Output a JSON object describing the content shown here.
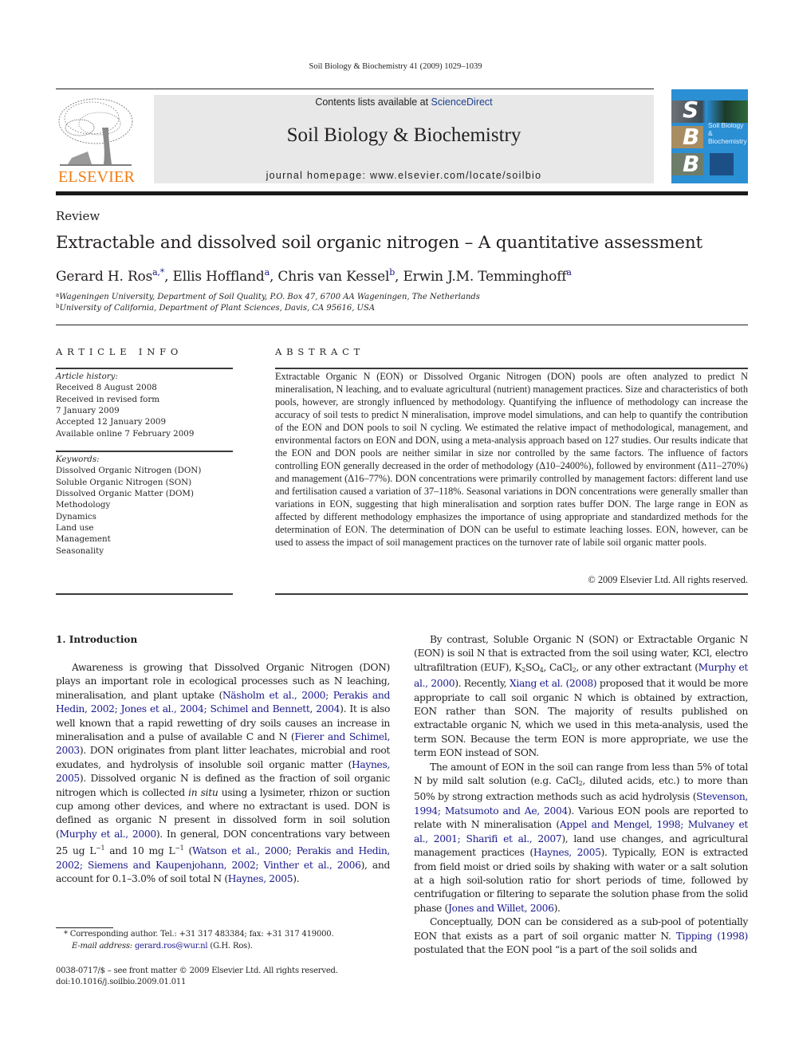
{
  "running_head": "Soil Biology & Biochemistry 41 (2009) 1029–1039",
  "masthead": {
    "publisher_wordmark": "ELSEVIER",
    "contents_prefix": "Contents lists available at ",
    "contents_link": "ScienceDirect",
    "journal_title": "Soil Biology & Biochemistry",
    "homepage": "journal homepage: www.elsevier.com/locate/soilbio",
    "cover": {
      "letters": [
        "S",
        "B",
        "B"
      ],
      "title_line1": "Soil Biology &",
      "title_line2": "Biochemistry",
      "color": "#2b8fd4"
    },
    "wordmark_color": "#f07c12"
  },
  "article": {
    "section_type": "Review",
    "title": "Extractable and dissolved soil organic nitrogen – A quantitative assessment",
    "authors": [
      {
        "name": "Gerard H. Ros",
        "sup": "a,*",
        "sep": ", "
      },
      {
        "name": "Ellis Hoffland",
        "sup": "a",
        "sep": ", "
      },
      {
        "name": "Chris van Kessel",
        "sup": "b",
        "sep": ", "
      },
      {
        "name": "Erwin J.M. Temminghoff",
        "sup": "a",
        "sep": ""
      }
    ],
    "affiliations": [
      {
        "mark": "a",
        "text": "Wageningen University, Department of Soil Quality, P.O. Box 47, 6700 AA Wageningen, The Netherlands"
      },
      {
        "mark": "b",
        "text": "University of California, Department of Plant Sciences, Davis, CA 95616, USA"
      }
    ]
  },
  "article_info": {
    "heading": "ARTICLE INFO",
    "history_label": "Article history:",
    "history": [
      "Received 8 August 2008",
      "Received in revised form",
      "7 January 2009",
      "Accepted 12 January 2009",
      "Available online 7 February 2009"
    ],
    "keywords_label": "Keywords:",
    "keywords": [
      "Dissolved Organic Nitrogen (DON)",
      "Soluble Organic Nitrogen (SON)",
      "Dissolved Organic Matter (DOM)",
      "Methodology",
      "Dynamics",
      "Land use",
      "Management",
      "Seasonality"
    ]
  },
  "abstract": {
    "heading": "ABSTRACT",
    "text": "Extractable Organic N (EON) or Dissolved Organic Nitrogen (DON) pools are often analyzed to predict N mineralisation, N leaching, and to evaluate agricultural (nutrient) management practices. Size and characteristics of both pools, however, are strongly influenced by methodology. Quantifying the influence of methodology can increase the accuracy of soil tests to predict N mineralisation, improve model simulations, and can help to quantify the contribution of the EON and DON pools to soil N cycling. We estimated the relative impact of methodological, management, and environmental factors on EON and DON, using a meta-analysis approach based on 127 studies. Our results indicate that the EON and DON pools are neither similar in size nor controlled by the same factors. The influence of factors controlling EON generally decreased in the order of methodology (Δ10–2400%), followed by environment (Δ11–270%) and management (Δ16–77%). DON concentrations were primarily controlled by management factors: different land use and fertilisation caused a variation of 37–118%. Seasonal variations in DON concentrations were generally smaller than variations in EON, suggesting that high mineralisation and sorption rates buffer DON. The large range in EON as affected by different methodology emphasizes the importance of using appropriate and standardized methods for the determination of EON. The determination of DON can be useful to estimate leaching losses. EON, however, can be used to assess the impact of soil management practices on the turnover rate of labile soil organic matter pools.",
    "copyright": "© 2009 Elsevier Ltd. All rights reserved."
  },
  "introduction": {
    "heading": "1.  Introduction",
    "left_p1": [
      {
        "t": "Awareness is growing that Dissolved Organic Nitrogen (DON) plays an important role in ecological processes such as N leaching, mineralisation, and plant uptake ("
      },
      {
        "t": "Näsholm et al., 2000; Perakis and Hedin, 2002; Jones et al., 2004; Schimel and Bennett, 2004",
        "link": true
      },
      {
        "t": "). It is also well known that a rapid rewetting of dry soils causes an increase in mineralisation and a pulse of available C and N ("
      },
      {
        "t": "Fierer and Schimel, 2003",
        "link": true
      },
      {
        "t": "). DON originates from plant litter leachates, microbial and root exudates, and hydrolysis of insoluble soil organic matter ("
      },
      {
        "t": "Haynes, 2005",
        "link": true
      },
      {
        "t": "). Dissolved organic N is defined as the fraction of soil organic nitrogen which is collected "
      },
      {
        "t": "in situ",
        "italic": true
      },
      {
        "t": " using a lysimeter, rhizon or suction cup among other devices, and where no extractant is used. DON is defined as organic N present in dissolved form in soil solution ("
      },
      {
        "t": "Murphy et al., 2000",
        "link": true
      },
      {
        "t": "). In general, DON concentrations vary between 25 ug L"
      },
      {
        "t": "−1",
        "sup": true
      },
      {
        "t": " and 10 mg L"
      },
      {
        "t": "−1",
        "sup": true
      },
      {
        "t": " ("
      },
      {
        "t": "Watson et al., 2000; Perakis and Hedin, 2002; Siemens and Kaupenjohann, 2002; Vinther et al., 2006",
        "link": true
      },
      {
        "t": "), and account for 0.1–3.0% of soil total N ("
      },
      {
        "t": "Haynes, 2005",
        "link": true
      },
      {
        "t": ")."
      }
    ],
    "right_p1": [
      {
        "t": "By contrast, Soluble Organic N (SON) or Extractable Organic N (EON) is soil N that is extracted from the soil using water, KCl, electro ultrafiltration (EUF), K"
      },
      {
        "t": "2",
        "sub": true
      },
      {
        "t": "SO"
      },
      {
        "t": "4",
        "sub": true
      },
      {
        "t": ", CaCl"
      },
      {
        "t": "2",
        "sub": true
      },
      {
        "t": ", or any other extractant ("
      },
      {
        "t": "Murphy et al., 2000",
        "link": true
      },
      {
        "t": "). Recently, "
      },
      {
        "t": "Xiang et al. (2008)",
        "link": true
      },
      {
        "t": " proposed that it would be more appropriate to call soil organic N which is obtained by extraction, EON rather than SON. The majority of results published on extractable organic N, which we used in this meta-analysis, used the term SON. Because the term EON is more appropriate, we use the term EON instead of SON."
      }
    ],
    "right_p2": [
      {
        "t": "The amount of EON in the soil can range from less than 5% of total N by mild salt solution (e.g. CaCl"
      },
      {
        "t": "2",
        "sub": true
      },
      {
        "t": ", diluted acids, etc.) to more than 50% by strong extraction methods such as acid hydrolysis ("
      },
      {
        "t": "Stevenson, 1994; Matsumoto and Ae, 2004",
        "link": true
      },
      {
        "t": "). Various EON pools are reported to relate with N mineralisation ("
      },
      {
        "t": "Appel and Mengel, 1998; Mulvaney et al., 2001; Sharifi et al., 2007",
        "link": true
      },
      {
        "t": "), land use changes, and agricultural management practices ("
      },
      {
        "t": "Haynes, 2005",
        "link": true
      },
      {
        "t": "). Typically, EON is extracted from field moist or dried soils by shaking with water or a salt solution at a high soil-solution ratio for short periods of time, followed by centrifugation or filtering to separate the solution phase from the solid phase ("
      },
      {
        "t": "Jones and Willet, 2006",
        "link": true
      },
      {
        "t": ")."
      }
    ],
    "right_p3": [
      {
        "t": "Conceptually, DON can be considered as a sub-pool of potentially EON that exists as a part of soil organic matter N. "
      },
      {
        "t": "Tipping (1998)",
        "link": true
      },
      {
        "t": " postulated that the EON pool “is a part of the soil solids and"
      }
    ]
  },
  "footnotes": {
    "corresponding": "*  Corresponding author. Tel.: +31 317 483384; fax: +31 317 419000.",
    "email_label": "E-mail address: ",
    "email": "gerard.ros@wur.nl",
    "email_suffix": " (G.H. Ros).",
    "front_matter": "0038-0717/$ – see front matter © 2009 Elsevier Ltd. All rights reserved.",
    "doi": "doi:10.1016/j.soilbio.2009.01.011"
  }
}
